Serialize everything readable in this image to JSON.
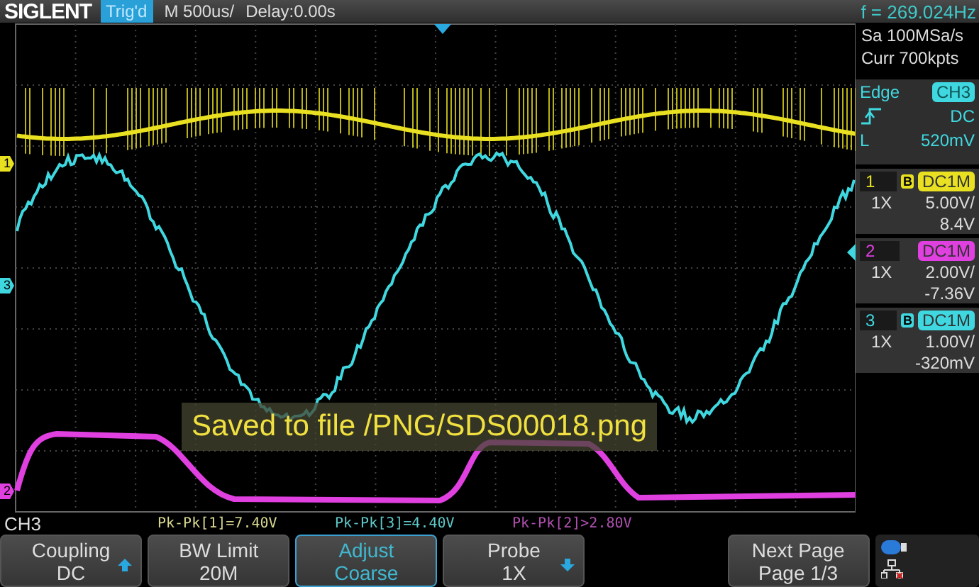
{
  "header": {
    "logo": "SIGLENT",
    "trigger_status": "Trig'd",
    "timebase": "M 500us/",
    "delay": "Delay:0.00s",
    "frequency": "f = 269.024Hz"
  },
  "traces": [
    {
      "label": "1",
      "color": "#e8e020"
    },
    {
      "label": "3",
      "color": "#40d8e0"
    },
    {
      "label": "2",
      "color": "#e040e0"
    }
  ],
  "message": "Saved to file /PNG/SDS00018.png",
  "acquisition": {
    "sample_rate": "Sa 100MSa/s",
    "memory": "Curr 700kpts"
  },
  "trigger": {
    "type": "Edge",
    "source": "CH3",
    "coupling": "DC",
    "level_label": "L",
    "level_value": "520mV"
  },
  "channels": [
    {
      "number": "1",
      "color": "#e8e020",
      "bw_limit": "B",
      "coupling": "DC1M",
      "probe": "1X",
      "scale": "5.00V/",
      "offset": "8.4V"
    },
    {
      "number": "2",
      "color": "#e040e0",
      "coupling": "DC1M",
      "probe": "1X",
      "scale": "2.00V/",
      "offset": "-7.36V"
    },
    {
      "number": "3",
      "color": "#40d8e0",
      "bw_limit": "B",
      "coupling": "DC1M",
      "probe": "1X",
      "scale": "1.00V/",
      "offset": "-320mV"
    }
  ],
  "menu": {
    "title": "CH3",
    "buttons": [
      {
        "kind": "button",
        "label": "Coupling",
        "value": "DC",
        "up_arrow": true,
        "selected": false
      },
      {
        "kind": "button",
        "label": "BW Limit",
        "value": "20M",
        "selected": false
      },
      {
        "kind": "button",
        "label": "Adjust",
        "value": "Coarse",
        "selected": true
      },
      {
        "kind": "button",
        "label": "Probe",
        "value": "1X",
        "down_arrow": true,
        "selected": false
      },
      {
        "kind": "empty"
      },
      {
        "kind": "button",
        "label": "Next Page",
        "value": "Page 1/3",
        "selected": false
      }
    ]
  },
  "measurements": [
    {
      "text": "Pk-Pk[1]=7.40V",
      "color": "#d8d890"
    },
    {
      "text": "Pk-Pk[3]=4.40V",
      "color": "#60c8c8"
    },
    {
      "text": "Pk-Pk[2]>2.80V",
      "color": "#b050b0"
    }
  ]
}
